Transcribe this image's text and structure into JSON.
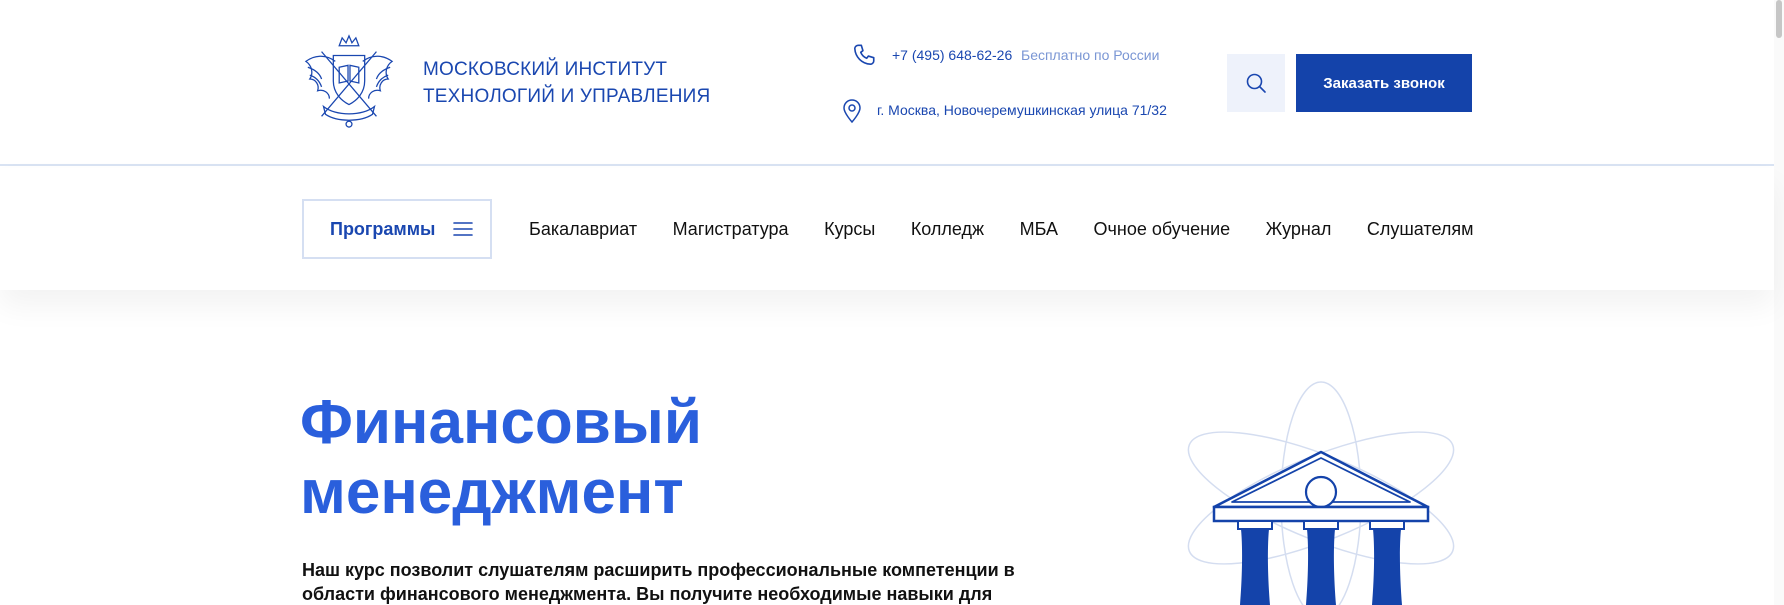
{
  "header": {
    "org_name_line1": "МОСКОВСКИЙ ИНСТИТУТ",
    "org_name_line2": "ТЕХНОЛОГИЙ И УПРАВЛЕНИЯ",
    "phone": "+7 (495) 648-62-26",
    "phone_note": "Бесплатно по России",
    "address": "г. Москва, Новочеремушкинская улица 71/32",
    "call_button": "Заказать звонок"
  },
  "nav": {
    "programs_label": "Программы",
    "links": [
      "Бакалавриат",
      "Магистратура",
      "Курсы",
      "Колледж",
      "МБА",
      "Очное обучение",
      "Журнал",
      "Слушателям"
    ]
  },
  "hero": {
    "title_line1": "Финансовый",
    "title_line2": "менеджмент",
    "text": "Наш курс позволит слушателям расширить профессиональные компетенции в области финансового менеджмента. Вы получите необходимые навыки для"
  },
  "colors": {
    "brand_blue": "#1443aa",
    "title_blue": "#2a5fdc",
    "muted_blue": "#7a96d4"
  },
  "icons": [
    "logo-emblem",
    "phone-icon",
    "location-pin-icon",
    "search-icon",
    "menu-icon",
    "bank-building-icon"
  ]
}
